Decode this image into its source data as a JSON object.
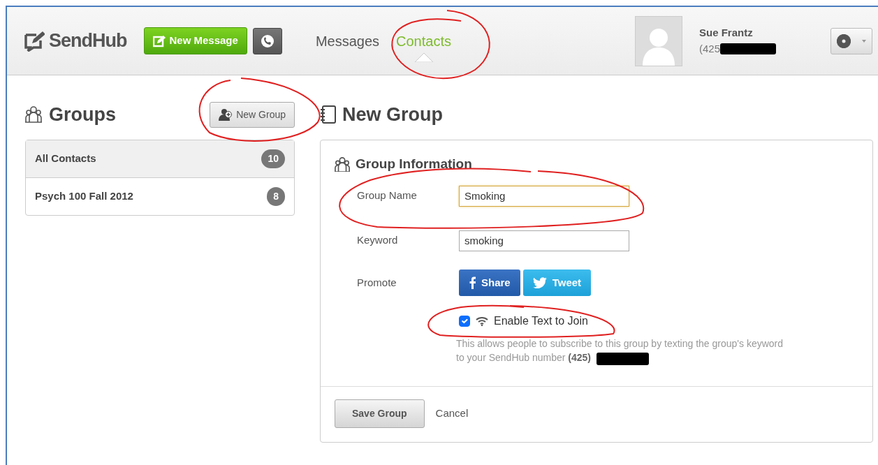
{
  "header": {
    "logo": "SendHub",
    "new_message_button": "New Message",
    "nav": [
      {
        "label": "Messages",
        "selected": false
      },
      {
        "label": "Contacts",
        "selected": true
      }
    ],
    "user": {
      "name": "Sue Frantz",
      "phone": "(425"
    }
  },
  "sidebar": {
    "title": "Groups",
    "new_group_button": "New Group",
    "groups": [
      {
        "name": "All Contacts",
        "count": "10",
        "selected": true
      },
      {
        "name": "Psych 100 Fall 2012",
        "count": "8",
        "selected": false
      }
    ]
  },
  "main": {
    "title": "New Group",
    "section_title": "Group Information",
    "fields": [
      {
        "label": "Group Name",
        "value": "Smoking",
        "focused": true
      },
      {
        "label": "Keyword",
        "value": "smoking",
        "focused": false
      }
    ],
    "promote_label": "Promote",
    "share_buttons": [
      {
        "kind": "facebook",
        "label": "Share"
      },
      {
        "kind": "twitter",
        "label": "Tweet"
      }
    ],
    "enable_text_to_join": {
      "label": "Enable Text to Join",
      "checked": true
    },
    "help_text": "This allows people to subscribe to this group by texting the group's keyword to your SendHub number **(425)**",
    "save_button": "Save Group",
    "cancel_link": "Cancel"
  }
}
